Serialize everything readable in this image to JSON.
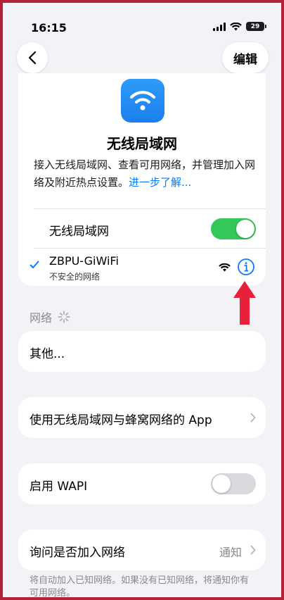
{
  "status_bar": {
    "time": "16:15",
    "battery": "29"
  },
  "nav": {
    "edit_label": "编辑"
  },
  "header": {
    "title": "无线局域网",
    "description": "接入无线局域网、查看可用网络，并管理加入网络及附近热点设置。",
    "learn_more": "进一步了解..."
  },
  "wifi_toggle": {
    "label": "无线局域网",
    "on": true
  },
  "connected_network": {
    "name": "ZBPU-GiWiFi",
    "subtitle": "不安全的网络"
  },
  "networks_section": {
    "header": "网络"
  },
  "other": {
    "label": "其他..."
  },
  "apps_row": {
    "label": "使用无线局域网与蜂窝网络的 App"
  },
  "wapi": {
    "label": "启用 WAPI",
    "on": false
  },
  "ask_join": {
    "label": "询问是否加入网络",
    "value": "通知"
  },
  "footer_note": "将自动加入已知网络。如果没有已知网络，将通知你有可用网络。",
  "colors": {
    "accent": "#0a7aff",
    "toggle_on": "#34c759",
    "annotation_arrow": "#e8203a",
    "frame": "#b4223a"
  },
  "icons": [
    "signal-icon",
    "wifi-icon",
    "battery-icon",
    "back-chevron-icon",
    "wifi-app-icon",
    "checkmark-icon",
    "info-icon",
    "loading-spinner-icon",
    "chevron-right-icon",
    "red-arrow-icon"
  ]
}
